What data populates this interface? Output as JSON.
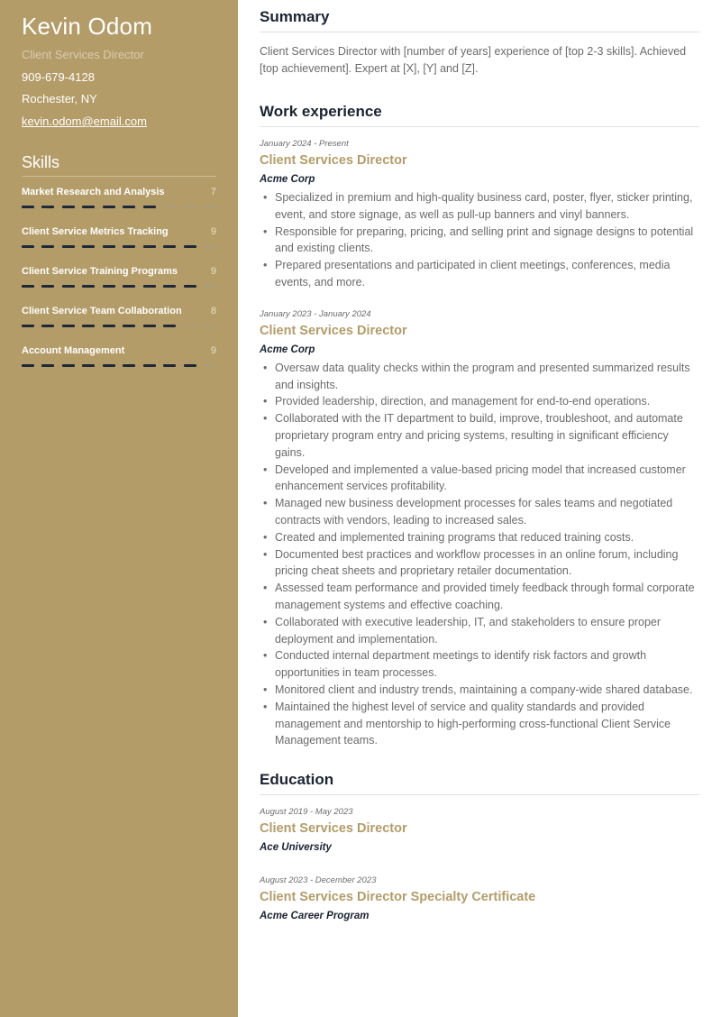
{
  "profile": {
    "name": "Kevin Odom",
    "title": "Client Services Director",
    "phone": "909-679-4128",
    "location": "Rochester, NY",
    "email": "kevin.odom@email.com"
  },
  "skills": {
    "heading": "Skills",
    "max_score": 10,
    "items": [
      {
        "name": "Market Research and Analysis",
        "score": 7,
        "score_label": "7"
      },
      {
        "name": "Client Service Metrics Tracking",
        "score": 9,
        "score_label": "9"
      },
      {
        "name": "Client Service Training Programs",
        "score": 9,
        "score_label": "9"
      },
      {
        "name": "Client Service Team Collaboration",
        "score": 8,
        "score_label": "8"
      },
      {
        "name": "Account Management",
        "score": 9,
        "score_label": "9"
      }
    ]
  },
  "colors": {
    "accent": "#b39c68",
    "heading": "#1a2332",
    "body_text": "#6b6b6b",
    "bar_filled": "#1e2939"
  },
  "summary": {
    "heading": "Summary",
    "text": "Client Services Director with [number of years] experience of [top 2-3 skills]. Achieved [top achievement]. Expert at [X], [Y] and [Z]."
  },
  "work": {
    "heading": "Work experience",
    "jobs": [
      {
        "dates": "January 2024 - Present",
        "role": "Client Services Director",
        "company": "Acme Corp",
        "bullets": [
          "Specialized in premium and high-quality business card, poster, flyer, sticker printing, event, and store signage, as well as pull-up banners and vinyl banners.",
          "Responsible for preparing, pricing, and selling print and signage designs to potential and existing clients.",
          "Prepared presentations and participated in client meetings, conferences, media events, and more."
        ]
      },
      {
        "dates": "January 2023 - January 2024",
        "role": "Client Services Director",
        "company": "Acme Corp",
        "bullets": [
          "Oversaw data quality checks within the program and presented summarized results and insights.",
          "Provided leadership, direction, and management for end-to-end operations.",
          "Collaborated with the IT department to build, improve, troubleshoot, and automate proprietary program entry and pricing systems, resulting in significant efficiency gains.",
          "Developed and implemented a value-based pricing model that increased customer enhancement services profitability.",
          "Managed new business development processes for sales teams and negotiated contracts with vendors, leading to increased sales.",
          "Created and implemented training programs that reduced training costs.",
          "Documented best practices and workflow processes in an online forum, including pricing cheat sheets and proprietary retailer documentation.",
          "Assessed team performance and provided timely feedback through formal corporate management systems and effective coaching.",
          "Collaborated with executive leadership, IT, and stakeholders to ensure proper deployment and implementation.",
          "Conducted internal department meetings to identify risk factors and growth opportunities in team processes.",
          "Monitored client and industry trends, maintaining a company-wide shared database.",
          "Maintained the highest level of service and quality standards and provided management and mentorship to high-performing cross-functional Client Service Management teams."
        ]
      }
    ]
  },
  "education": {
    "heading": "Education",
    "entries": [
      {
        "dates": "August 2019 - May 2023",
        "degree": "Client Services Director",
        "school": "Ace University"
      },
      {
        "dates": "August 2023 - December 2023",
        "degree": "Client Services Director Specialty Certificate",
        "school": "Acme Career Program"
      }
    ]
  }
}
